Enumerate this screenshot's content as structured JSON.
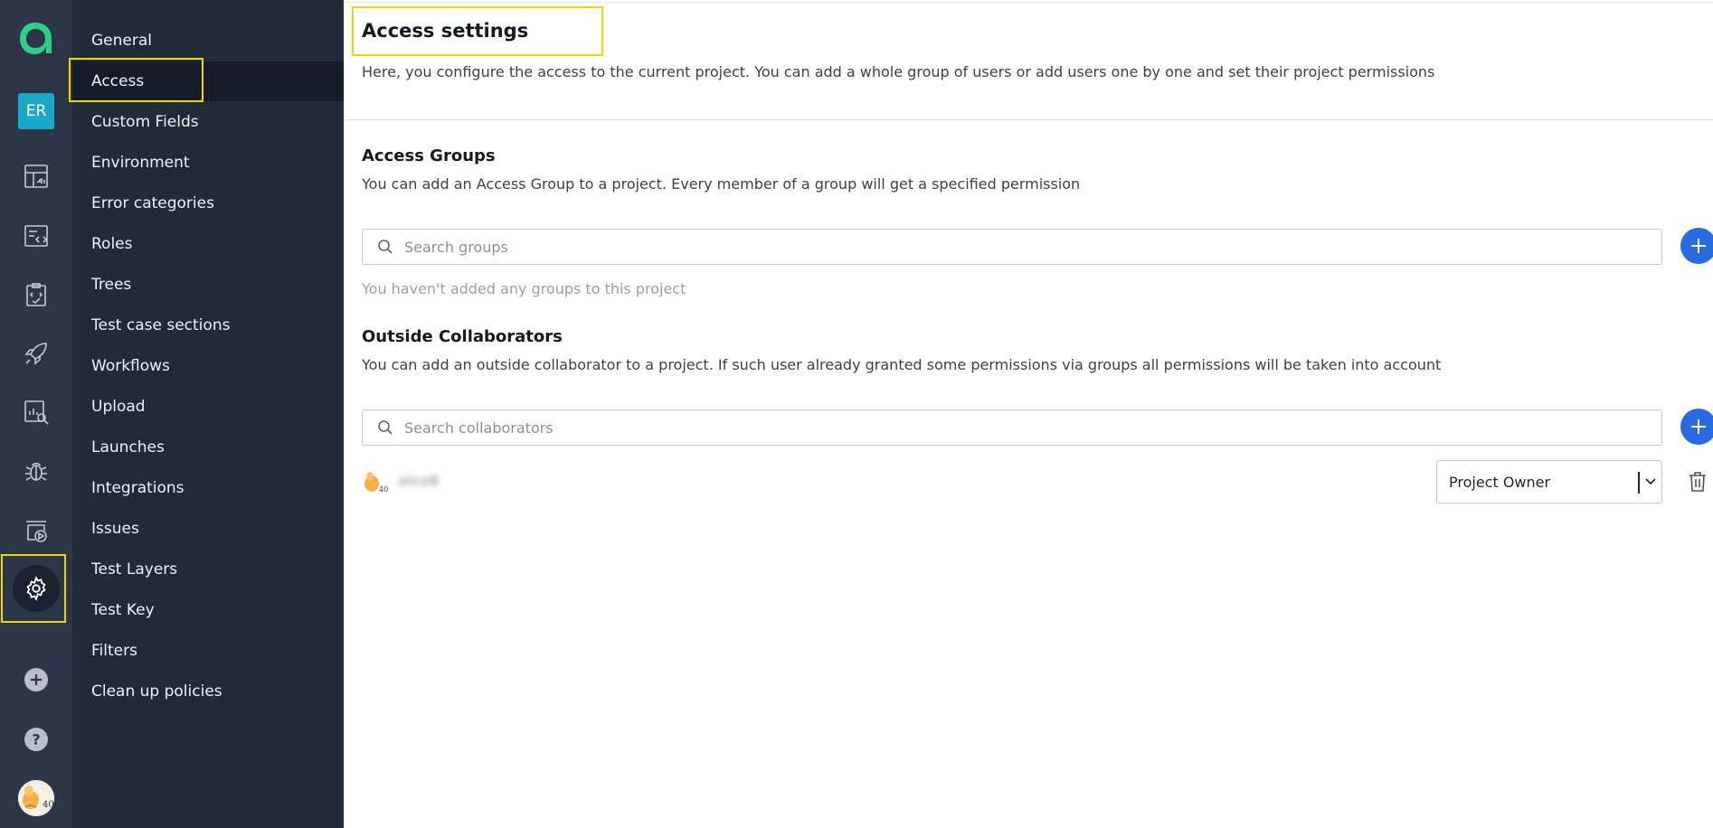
{
  "rail": {
    "project_initials": "ER",
    "icons": [
      "app-logo-icon",
      "dashboard-icon",
      "test-cases-icon",
      "test-plans-icon",
      "launches-icon",
      "analytics-icon",
      "defects-icon",
      "jobs-icon",
      "settings-icon",
      "add-project-icon",
      "help-icon",
      "user-avatar"
    ]
  },
  "subnav": {
    "items": [
      {
        "label": "General"
      },
      {
        "label": "Access"
      },
      {
        "label": "Custom Fields"
      },
      {
        "label": "Environment"
      },
      {
        "label": "Error categories"
      },
      {
        "label": "Roles"
      },
      {
        "label": "Trees"
      },
      {
        "label": "Test case sections"
      },
      {
        "label": "Workflows"
      },
      {
        "label": "Upload"
      },
      {
        "label": "Launches"
      },
      {
        "label": "Integrations"
      },
      {
        "label": "Issues"
      },
      {
        "label": "Test Layers"
      },
      {
        "label": "Test Key"
      },
      {
        "label": "Filters"
      },
      {
        "label": "Clean up policies"
      }
    ],
    "active_index": 1
  },
  "main": {
    "title": "Access settings",
    "description": "Here, you configure the access to the current project. You can add a whole group of users or add users one by one and set their project permissions",
    "groups": {
      "title": "Access Groups",
      "description": "You can add an Access Group to a project. Every member of a group will get a specified permission",
      "search_placeholder": "Search groups",
      "empty_text": "You haven't added any groups to this project"
    },
    "collaborators": {
      "title": "Outside Collaborators",
      "description": "You can add an outside collaborator to a project. If such user already granted some permissions via groups all permissions will be taken into account",
      "search_placeholder": "Search collaborators",
      "rows": [
        {
          "name": "aliceB",
          "role": "Project Owner"
        }
      ]
    }
  },
  "colors": {
    "rail_bg": "#2c3646",
    "subnav_bg": "#212a39",
    "accent_blue": "#2a6ae0",
    "highlight_yellow": "#f3d400",
    "logo_green": "#2fcf8a",
    "project_badge": "#1ba8c7"
  }
}
